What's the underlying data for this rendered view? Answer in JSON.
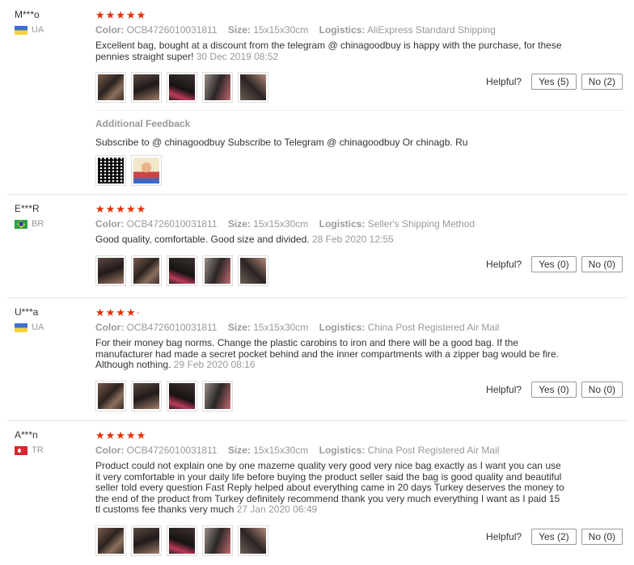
{
  "reviews": [
    {
      "user": "M***o",
      "country": "UA",
      "stars": "★★★★★",
      "color_label": "Color:",
      "color_value": "OCB4726010031811",
      "size_label": "Size:",
      "size_value": "15x15x30cm",
      "logistics_label": "Logistics:",
      "logistics_value": "AliExpress Standard Shipping",
      "text": "Excellent bag, bought at a discount from the telegram @ chinagoodbuy is happy with the purchase, for these pennies straight super!",
      "date": "30 Dec 2019 08:52",
      "helpful_label": "Helpful?",
      "yes": "Yes (5)",
      "no": "No (2)",
      "additional_title": "Additional Feedback",
      "additional_text": "Subscribe to @ chinagoodbuy Subscribe to Telegram @ chinagoodbuy Or chinagb. Ru"
    },
    {
      "user": "E***R",
      "country": "BR",
      "stars": "★★★★★",
      "color_label": "Color:",
      "color_value": "OCB4726010031811",
      "size_label": "Size:",
      "size_value": "15x15x30cm",
      "logistics_label": "Logistics:",
      "logistics_value": "Seller's Shipping Method",
      "text": "Good quality, comfortable. Good size and divided.",
      "date": "28 Feb 2020 12:55",
      "helpful_label": "Helpful?",
      "yes": "Yes (0)",
      "no": "No (0)"
    },
    {
      "user": "U***a",
      "country": "UA",
      "stars": "★★★★·",
      "color_label": "Color:",
      "color_value": "OCB4726010031811",
      "size_label": "Size:",
      "size_value": "15x15x30cm",
      "logistics_label": "Logistics:",
      "logistics_value": "China Post Registered Air Mail",
      "text": "For their money bag norms. Change the plastic carobins to iron and there will be a good bag. If the manufacturer had made a secret pocket behind and the inner compartments with a zipper bag would be fire. Although nothing.",
      "date": "29 Feb 2020 08:16",
      "helpful_label": "Helpful?",
      "yes": "Yes (0)",
      "no": "No (0)"
    },
    {
      "user": "A***n",
      "country": "TR",
      "stars": "★★★★★",
      "color_label": "Color:",
      "color_value": "OCB4726010031811",
      "size_label": "Size:",
      "size_value": "15x15x30cm",
      "logistics_label": "Logistics:",
      "logistics_value": "China Post Registered Air Mail",
      "text": "Product could not explain one by one mazeme quality very good very nice bag exactly as I want you can use it very comfortable in your daily life before buying the product seller said the bag is good quality and beautiful seller told every question Fast Reply helped about everything came in 20 days Turkey deserves the money to the end of the product from Turkey definitely recommend thank you very much everything I want as I paid 15 tl customs fee thanks very much",
      "date": "27 Jan 2020 06:49",
      "helpful_label": "Helpful?",
      "yes": "Yes (2)",
      "no": "No (0)"
    }
  ],
  "colors": {
    "star": "#e62e04",
    "muted": "#999999",
    "text": "#333333"
  }
}
